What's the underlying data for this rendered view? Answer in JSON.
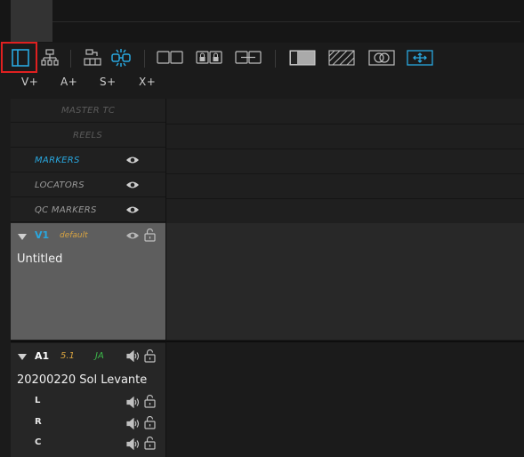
{
  "add_buttons": [
    "V+",
    "A+",
    "S+",
    "X+"
  ],
  "rows": [
    {
      "label": "MASTER TC",
      "color": "#5b5b5b",
      "eye": false
    },
    {
      "label": "REELS",
      "color": "#5b5b5b",
      "eye": false
    },
    {
      "label": "MARKERS",
      "color": "#29a8e0",
      "eye": true
    },
    {
      "label": "LOCATORS",
      "color": "#9a9a9a",
      "eye": true
    },
    {
      "label": "QC MARKERS",
      "color": "#9a9a9a",
      "eye": true
    }
  ],
  "video_track": {
    "id": "V1",
    "tag": "default",
    "name": "Untitled"
  },
  "audio_track": {
    "id": "A1",
    "format": "5.1",
    "language": "JA",
    "name": "20200220 Sol Levante",
    "channels": [
      "L",
      "R",
      "C"
    ]
  },
  "colors": {
    "accent": "#29a8e0",
    "tag": "#d9a441",
    "highlight": "#e02020"
  }
}
